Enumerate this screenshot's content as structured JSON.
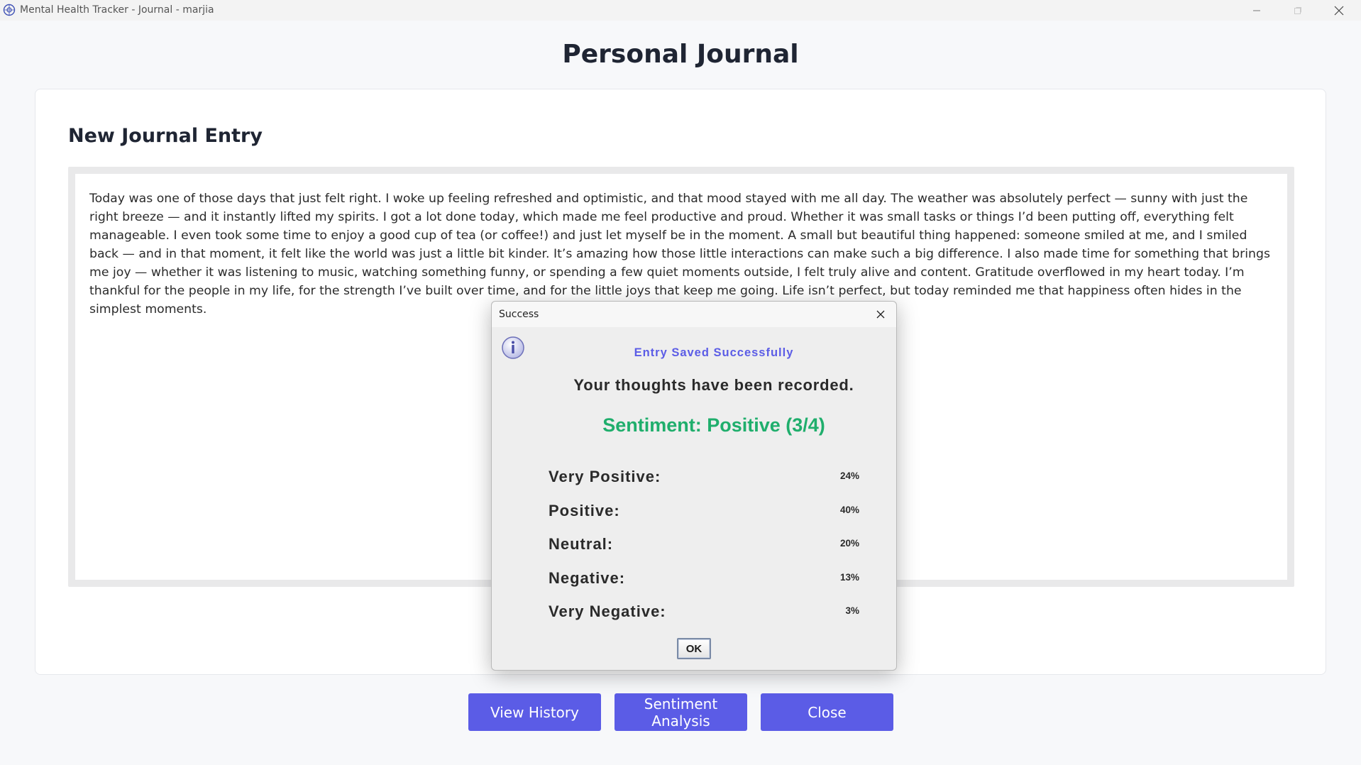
{
  "window": {
    "title": "Mental Health Tracker - Journal - marjia",
    "icons": {
      "app": "app-logo-icon",
      "minimize": "minimize-icon",
      "maximize": "maximize-icon",
      "close": "close-icon"
    }
  },
  "page": {
    "title": "Personal Journal",
    "section_title": "New Journal Entry",
    "entry_text": "Today was one of those days that just felt right. I woke up feeling refreshed and optimistic, and that mood stayed with me all day. The weather was absolutely perfect — sunny with just the right breeze — and it instantly lifted my spirits. I got a lot done today, which made me feel productive and proud. Whether it was small tasks or things I’d been putting off, everything felt manageable. I even took some time to enjoy a good cup of tea (or coffee!) and just let myself be in the moment. A small but beautiful thing happened: someone smiled at me, and I smiled back — and in that moment, it felt like the world was just a little bit kinder. It’s amazing how those little interactions can make such a big difference. I also made time for something that brings me joy — whether it was listening to music, watching something funny, or spending a few quiet moments outside, I felt truly alive and content. Gratitude overflowed in my heart today. I’m thankful for the people in my life, for the strength I’ve built over time, and for the little joys that keep me going. Life isn’t perfect, but today reminded me that happiness often hides in the simplest moments."
  },
  "actions": {
    "view_history": "View History",
    "sentiment_analysis": "Sentiment Analysis",
    "close": "Close"
  },
  "dialog": {
    "title": "Success",
    "icon": "info-icon",
    "heading": "Entry Saved Successfully",
    "message": "Your thoughts have been recorded.",
    "sentiment": "Sentiment: Positive (3/4)",
    "distribution": [
      {
        "label": "Very Positive:",
        "value": "24%"
      },
      {
        "label": "Positive:",
        "value": "40%"
      },
      {
        "label": "Neutral:",
        "value": "20%"
      },
      {
        "label": "Negative:",
        "value": "13%"
      },
      {
        "label": "Very Negative:",
        "value": "3%"
      }
    ],
    "ok_label": "OK"
  },
  "colors": {
    "accent": "#5b5ce6",
    "sentiment_positive": "#1fae6c",
    "background": "#f7f8fa"
  }
}
